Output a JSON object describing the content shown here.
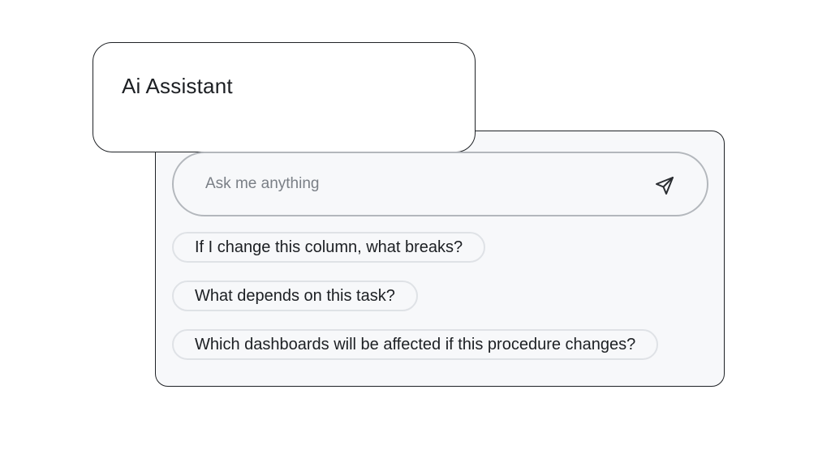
{
  "header": {
    "title": "Ai Assistant"
  },
  "input": {
    "placeholder": "Ask me anything",
    "value": ""
  },
  "send_button": {
    "icon": "send-icon"
  },
  "suggestions": [
    {
      "label": "If I change this column, what breaks?"
    },
    {
      "label": "What depends on this task?"
    },
    {
      "label": "Which dashboards will be affected if this procedure changes?"
    }
  ],
  "colors": {
    "border": "#1f2226",
    "panel_bg": "#f7f8fa",
    "input_border": "#b3b7bc",
    "chip_border": "#dfe2e6",
    "text": "#1c1f23",
    "placeholder": "#7a7f86"
  }
}
